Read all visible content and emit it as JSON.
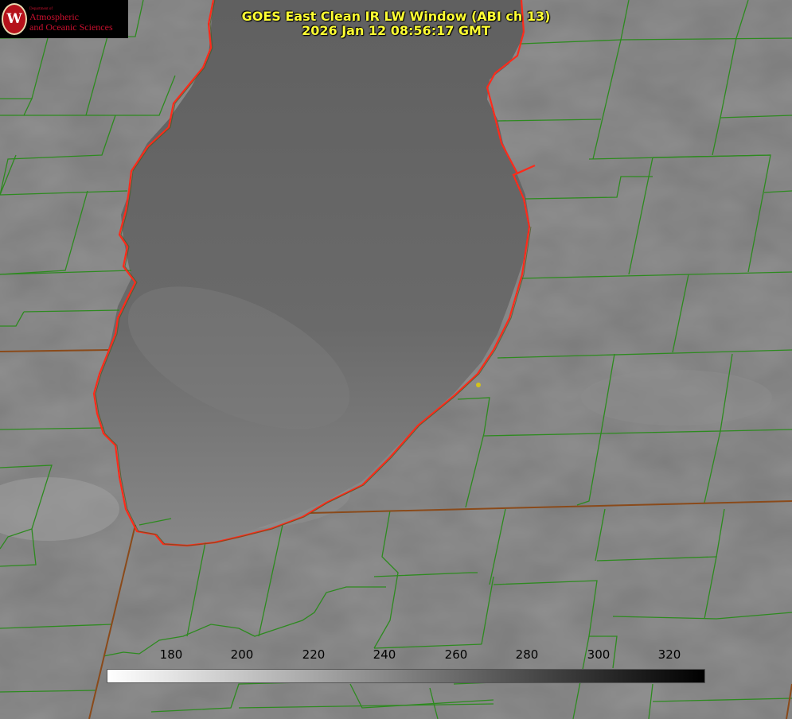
{
  "header": {
    "title_line1": "GOES East Clean IR LW Window (ABI ch 13)",
    "title_line2": "2026 Jan 12 08:56:17 GMT"
  },
  "logo": {
    "seal_letter": "W",
    "department": "Department of",
    "line1": "Atmospheric",
    "line2": "and Oceanic Sciences"
  },
  "colorbar": {
    "tick_labels": [
      "180",
      "200",
      "220",
      "240",
      "260",
      "280",
      "300",
      "320"
    ],
    "palette": [
      "#ffffff",
      "#000000"
    ]
  },
  "map": {
    "boundary_colors": {
      "lake_shore": "#ff2a1a",
      "county_lines": "#2d8a1f",
      "state_lines": "#8a4a1a"
    },
    "marker_color": "#d4c21a"
  }
}
